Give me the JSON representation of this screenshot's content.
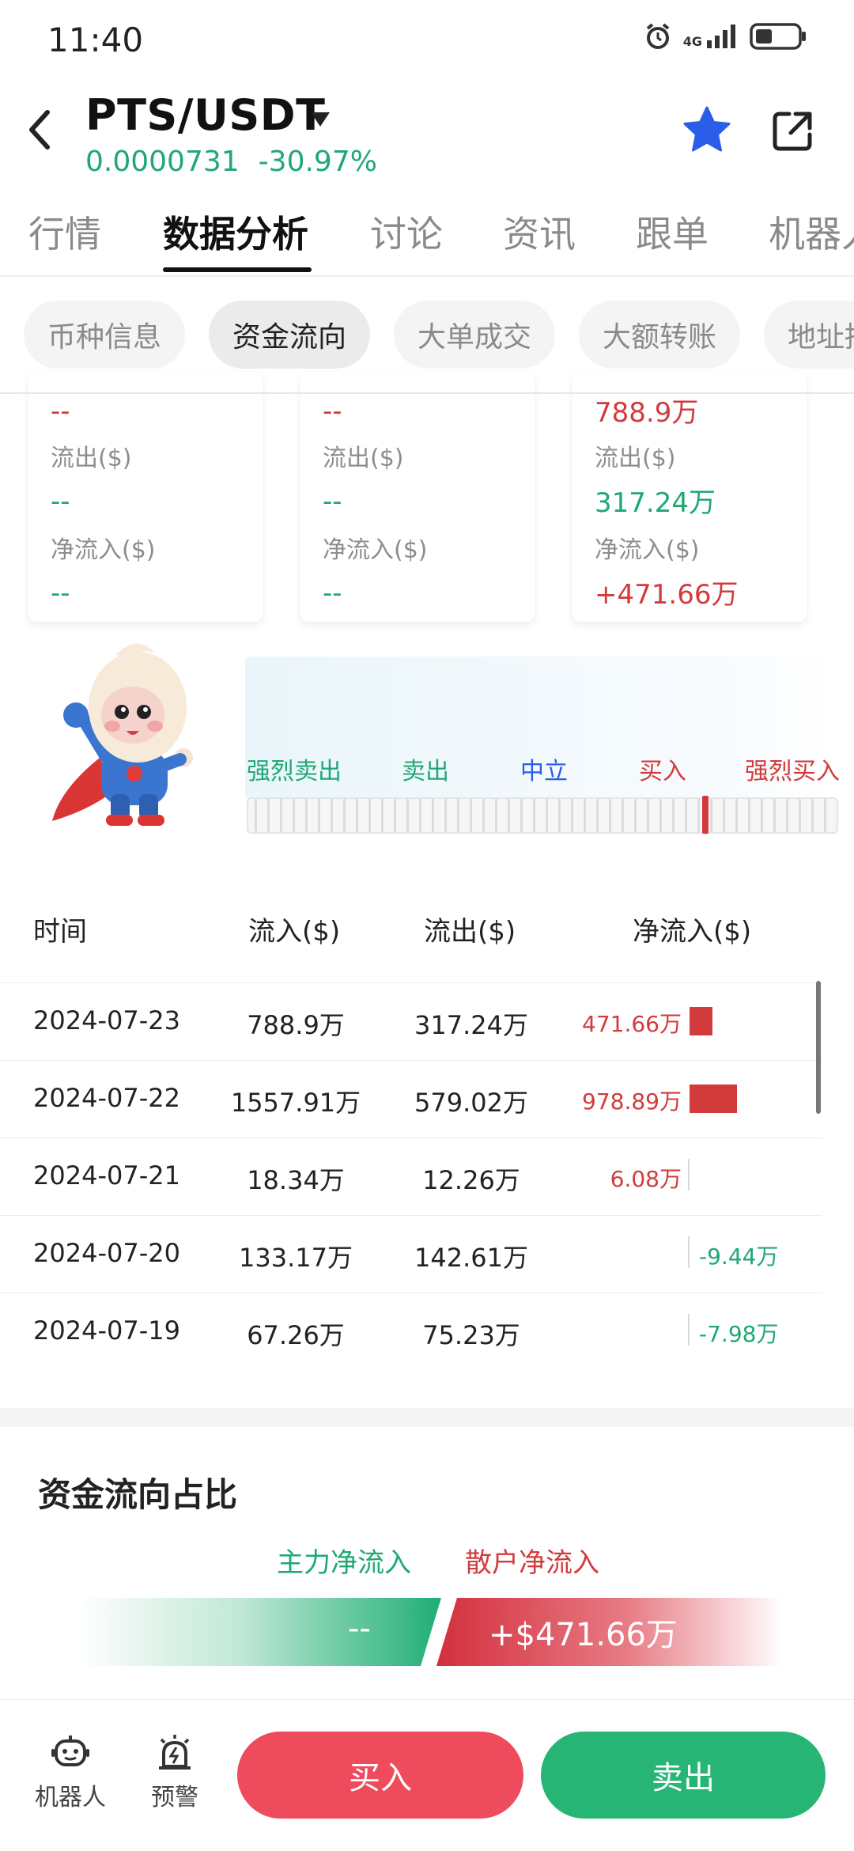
{
  "status": {
    "time": "11:40",
    "network": "4G"
  },
  "header": {
    "pair": "PTS/USDT",
    "price": "0.0000731",
    "change": "-30.97%"
  },
  "main_tabs": [
    "行情",
    "数据分析",
    "讨论",
    "资讯",
    "跟单",
    "机器人"
  ],
  "sub_tabs": [
    "币种信息",
    "资金流向",
    "大单成交",
    "大额转账",
    "地址持"
  ],
  "stat_cards": [
    {
      "top_value": "--",
      "outflow_label": "流出($)",
      "outflow": "--",
      "net_label": "净流入($)",
      "net": "--"
    },
    {
      "top_value": "--",
      "outflow_label": "流出($)",
      "outflow": "--",
      "net_label": "净流入($)",
      "net": "--"
    },
    {
      "top_value": "788.9万",
      "outflow_label": "流出($)",
      "outflow": "317.24万",
      "net_label": "净流入($)",
      "net": "+471.66万"
    }
  ],
  "sentiment": {
    "labels": [
      "强烈卖出",
      "卖出",
      "中立",
      "买入",
      "强烈买入"
    ],
    "level": 0.77
  },
  "flow_table": {
    "headers": [
      "时间",
      "流入($)",
      "流出($)",
      "净流入($)"
    ],
    "rows": [
      {
        "date": "2024-07-23",
        "inflow": "788.9万",
        "outflow": "317.24万",
        "net": "471.66万",
        "net_value": 471.66
      },
      {
        "date": "2024-07-22",
        "inflow": "1557.91万",
        "outflow": "579.02万",
        "net": "978.89万",
        "net_value": 978.89
      },
      {
        "date": "2024-07-21",
        "inflow": "18.34万",
        "outflow": "12.26万",
        "net": "6.08万",
        "net_value": 6.08
      },
      {
        "date": "2024-07-20",
        "inflow": "133.17万",
        "outflow": "142.61万",
        "net": "-9.44万",
        "net_value": -9.44
      },
      {
        "date": "2024-07-19",
        "inflow": "67.26万",
        "outflow": "75.23万",
        "net": "-7.98万",
        "net_value": -7.98
      }
    ]
  },
  "ratio": {
    "title": "资金流向占比",
    "main_label": "主力净流入",
    "retail_label": "散户净流入",
    "main_value": "--",
    "retail_value": "+$471.66万"
  },
  "bottom_bar": {
    "robot_label": "机器人",
    "alert_label": "预警",
    "buy_label": "买入",
    "sell_label": "卖出"
  },
  "colors": {
    "up_green": "#1fa874",
    "down_red": "#d23b3b",
    "buy_button": "#ee4b5c",
    "sell_button": "#26b574",
    "star_blue": "#2a5de8"
  }
}
